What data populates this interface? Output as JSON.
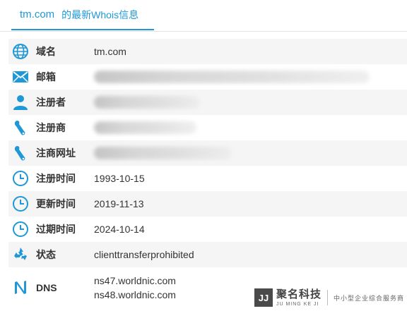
{
  "tab": {
    "domain": "tm.com",
    "suffix": "的最新Whois信息"
  },
  "colors": {
    "accent": "#1e98d7",
    "row_alt": "#f5f5f5"
  },
  "rows": [
    {
      "icon": "globe-icon",
      "label": "域名",
      "value": "tm.com"
    },
    {
      "icon": "envelope-icon",
      "label": "邮箱",
      "value": ""
    },
    {
      "icon": "person-icon",
      "label": "注册者",
      "value": ""
    },
    {
      "icon": "wrench-icon",
      "label": "注册商",
      "value": ""
    },
    {
      "icon": "wrench-icon",
      "label": "注商网址",
      "value": ""
    },
    {
      "icon": "clock-icon",
      "label": "注册时间",
      "value": "1993-10-15"
    },
    {
      "icon": "clock-icon",
      "label": "更新时间",
      "value": "2019-11-13"
    },
    {
      "icon": "clock-icon",
      "label": "过期时间",
      "value": "2024-10-14"
    },
    {
      "icon": "recycle-icon",
      "label": "状态",
      "value": "clienttransferprohibited"
    }
  ],
  "dns": {
    "icon": "dns-icon",
    "label": "DNS",
    "values": [
      "ns47.worldnic.com",
      "ns48.worldnic.com"
    ]
  },
  "watermark": {
    "logo": "JJ",
    "cn": "聚名科技",
    "en": "JU MING KE JI",
    "sub": "中小型企业综合服务商"
  }
}
